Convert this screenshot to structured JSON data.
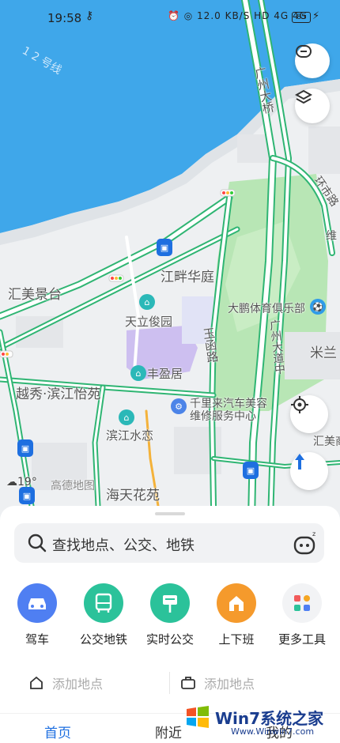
{
  "status": {
    "time": "19:58",
    "key_icon": "key-icon",
    "network": "12.0 KB/S",
    "hd": "HD",
    "signal1": "4G",
    "signal2": "4G",
    "battery": "85"
  },
  "map": {
    "labels": {
      "jiangpan": "江畔华庭",
      "huimei": "汇美景台",
      "tianli": "天立俊园",
      "fengying": "丰盈居",
      "yuexiu": "越秀·滨江怡苑",
      "binjiang": "滨江水恋",
      "haitian": "海天花苑",
      "dapeng": "大鹏体育俱乐部",
      "qianli1": "千里来汽车美容",
      "qianli2": "维修服务中心",
      "mi": "米兰",
      "huimei2": "汇美商",
      "yuhan": "玉函路",
      "guangzhou_bridge": "广州大桥",
      "guangzhou_rd": "广州大道中",
      "huanshi": "环市路",
      "wei": "维",
      "line12": "1 2 号线",
      "amap": "高德地图",
      "weather": "19°"
    }
  },
  "buttons": {
    "feedback_icon": "message-icon",
    "layers_icon": "layers-icon",
    "locate_icon": "locate-icon",
    "direction_icon": "direction-icon"
  },
  "search": {
    "placeholder": "查找地点、公交、地铁"
  },
  "tools": [
    {
      "label": "驾车",
      "icon": "car-icon",
      "color": "#4f7ff2"
    },
    {
      "label": "公交地铁",
      "icon": "bus-icon",
      "color": "#2bc29a"
    },
    {
      "label": "实时公交",
      "icon": "bus-stop-icon",
      "color": "#2bc29a"
    },
    {
      "label": "上下班",
      "icon": "home-icon",
      "color": "#f59a2c"
    },
    {
      "label": "更多工具",
      "icon": "apps-icon",
      "color": "#f2f3f5"
    }
  ],
  "quick": {
    "home": "添加地点",
    "work": "添加地点"
  },
  "tabs": [
    "首页",
    "附近",
    "我的"
  ],
  "watermark": {
    "text": "Win7系统之家",
    "url": "Www.Winwin7.com"
  }
}
